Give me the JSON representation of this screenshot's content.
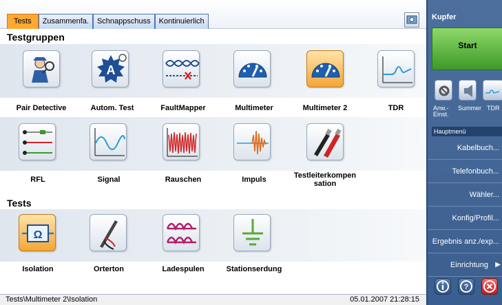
{
  "tabs": [
    {
      "label": "Tests",
      "active": true
    },
    {
      "label": "Zusammenfa.",
      "active": false
    },
    {
      "label": "Schnappschuss",
      "active": false
    },
    {
      "label": "Kontinuierlich",
      "active": false
    }
  ],
  "sections": {
    "groups_title": "Testgruppen",
    "tests_title": "Tests"
  },
  "groups": [
    {
      "label": "Pair Detective",
      "icon": "detective-icon"
    },
    {
      "label": "Autom. Test",
      "icon": "auto-test-icon"
    },
    {
      "label": "FaultMapper",
      "icon": "fault-mapper-icon"
    },
    {
      "label": "Multimeter",
      "icon": "gauge-icon"
    },
    {
      "label": "Multimeter 2",
      "icon": "gauge-icon",
      "selected": true
    },
    {
      "label": "TDR",
      "icon": "tdr-waveform-icon"
    },
    {
      "label": "RFL",
      "icon": "rfl-icon"
    },
    {
      "label": "Signal",
      "icon": "sine-wave-icon"
    },
    {
      "label": "Rauschen",
      "icon": "noise-icon"
    },
    {
      "label": "Impuls",
      "icon": "impulse-icon"
    },
    {
      "label": "Testleiterkompen sation",
      "icon": "test-leads-icon"
    }
  ],
  "tests": [
    {
      "label": "Isolation",
      "icon": "isolation-icon",
      "selected": true
    },
    {
      "label": "Orterton",
      "icon": "probe-icon"
    },
    {
      "label": "Ladespulen",
      "icon": "load-coil-icon"
    },
    {
      "label": "Stationserdung",
      "icon": "ground-icon"
    }
  ],
  "status": {
    "path": "Tests\\Multimeter 2\\Isolation",
    "datetime": "05.01.2007 21:28:15"
  },
  "side": {
    "title": "Kupfer",
    "start_label": "Start",
    "quick": [
      {
        "label": "Anw.- Einst.",
        "icon": "settings-icon"
      },
      {
        "label": "Summer",
        "icon": "speaker-icon"
      },
      {
        "label": "TDR",
        "icon": "tdr-mini-icon"
      }
    ],
    "menu_header": "Hauptmenü",
    "menu": [
      "Kabelbuch...",
      "Telefonbuch...",
      "Wähler...",
      "Konfig/Profil...",
      "Ergebnis anz./exp...",
      "Einrichtung"
    ],
    "bottom_buttons": [
      "info-icon",
      "help-icon",
      "close-icon"
    ]
  },
  "colors": {
    "accent": "#ffa832",
    "side_bg": "#3f628f",
    "start_green": "#4caf32"
  }
}
